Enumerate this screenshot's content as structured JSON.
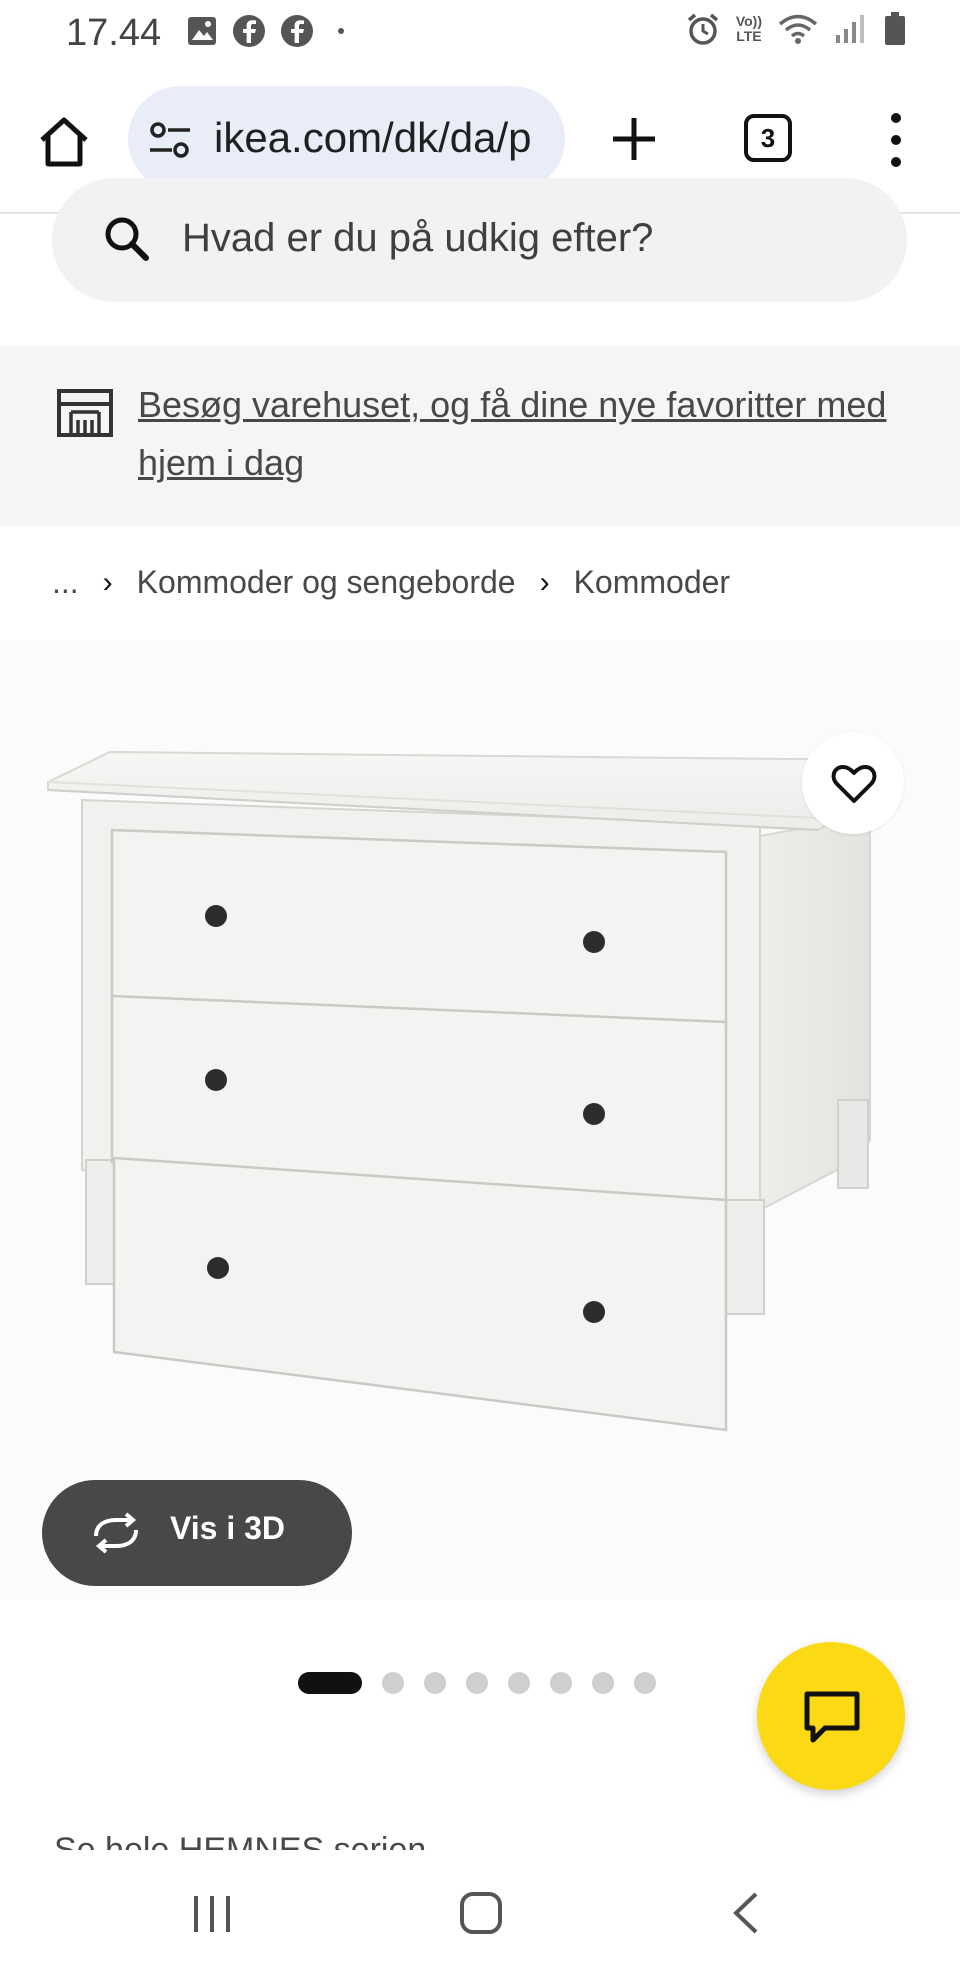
{
  "status_bar": {
    "time": "17.44",
    "left_icons": [
      "image-icon",
      "facebook-icon",
      "facebook-icon",
      "dot-icon"
    ],
    "right_icons": [
      "alarm-icon",
      "volte-icon",
      "wifi-icon",
      "signal-icon",
      "battery-icon"
    ],
    "volte_label_top": "Vo))",
    "volte_label_bottom": "LTE"
  },
  "browser": {
    "url": "ikea.com/dk/da/p",
    "tab_count": "3",
    "icons": [
      "home-icon",
      "tune-icon",
      "plus-icon",
      "tabs-icon",
      "more-vert-icon"
    ]
  },
  "search": {
    "placeholder": "Hvad er du på udkig efter?"
  },
  "store_banner": {
    "text": "Besøg varehuset, og få dine nye favoritter med hjem i dag",
    "icon": "store-icon"
  },
  "breadcrumb": {
    "items": [
      "...",
      "Kommoder og sengeborde",
      "Kommoder"
    ],
    "separator": "›"
  },
  "product_gallery": {
    "image_subject": "white three-drawer chest",
    "favorite_icon": "heart-icon",
    "view_3d_label": "Vis i 3D",
    "view_3d_icon": "rotate-3d-icon",
    "dot_count": 8,
    "active_dot_index": 0
  },
  "chat": {
    "icon": "chat-icon",
    "color": "#fbd914"
  },
  "series_link": "Se hele HEMNES serien",
  "nav_bar": {
    "icons": [
      "recents-icon",
      "home-nav-icon",
      "back-icon"
    ]
  },
  "colors": {
    "url_bar_bg": "#e8edf7",
    "banner_bg": "#f5f5f5",
    "button_dark": "#484848",
    "accent_yellow": "#fbd914"
  }
}
